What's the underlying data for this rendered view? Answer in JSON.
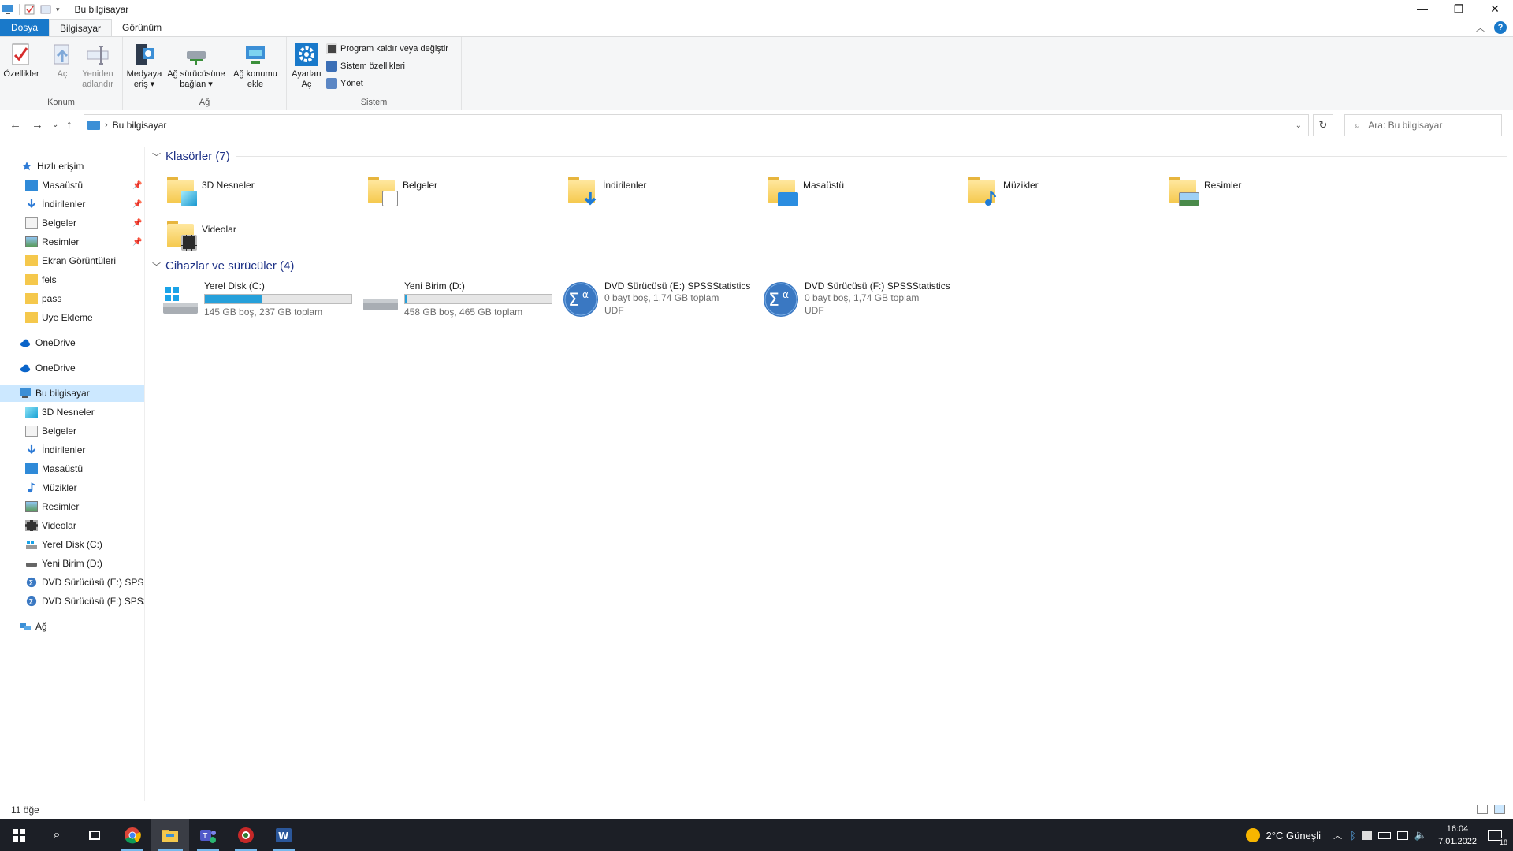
{
  "window": {
    "title": "Bu bilgisayar",
    "controls": {
      "minimize": "—",
      "maximize": "❐",
      "close": "✕"
    }
  },
  "ribbon_tabs": [
    {
      "label": "Dosya"
    },
    {
      "label": "Bilgisayar"
    },
    {
      "label": "Görünüm"
    }
  ],
  "ribbon": {
    "groups": {
      "konum": "Konum",
      "ag": "Ağ",
      "sistem": "Sistem"
    },
    "buttons": {
      "ozellikler": "Özellikler",
      "ac": "Aç",
      "yeniden_line1": "Yeniden",
      "yeniden_line2": "adlandır",
      "medya_line1": "Medyaya",
      "medya_line2": "eriş",
      "agsurucu_line1": "Ağ sürücüsüne",
      "agsurucu_line2": "bağlan",
      "agkonum_line1": "Ağ konumu",
      "agkonum_line2": "ekle",
      "ayarlar_line1": "Ayarları",
      "ayarlar_line2": "Aç",
      "program": "Program kaldır veya değiştir",
      "sistem_ozellikleri": "Sistem özellikleri",
      "yonet": "Yönet"
    }
  },
  "address": {
    "path": "Bu bilgisayar",
    "search_placeholder": "Ara: Bu bilgisayar"
  },
  "sidebar": {
    "quick_access": "Hızlı erişim",
    "quick_items": [
      {
        "label": "Masaüstü",
        "pinned": true
      },
      {
        "label": "İndirilenler",
        "pinned": true
      },
      {
        "label": "Belgeler",
        "pinned": true
      },
      {
        "label": "Resimler",
        "pinned": true
      },
      {
        "label": "Ekran Görüntüleri",
        "pinned": false
      },
      {
        "label": "fels",
        "pinned": false
      },
      {
        "label": "pass",
        "pinned": false
      },
      {
        "label": "Uye Ekleme",
        "pinned": false
      }
    ],
    "onedrive1": "OneDrive",
    "onedrive2": "OneDrive",
    "this_pc": "Bu bilgisayar",
    "pc_items": [
      {
        "label": "3D Nesneler"
      },
      {
        "label": "Belgeler"
      },
      {
        "label": "İndirilenler"
      },
      {
        "label": "Masaüstü"
      },
      {
        "label": "Müzikler"
      },
      {
        "label": "Resimler"
      },
      {
        "label": "Videolar"
      },
      {
        "label": "Yerel Disk (C:)"
      },
      {
        "label": "Yeni Birim (D:)"
      },
      {
        "label": "DVD Sürücüsü (E:) SPSSStatistics"
      },
      {
        "label": "DVD Sürücüsü (F:) SPSSStatistics"
      }
    ],
    "network": "Ağ"
  },
  "content": {
    "folders_header": "Klasörler (7)",
    "folders": [
      {
        "name": "3D Nesneler"
      },
      {
        "name": "Belgeler"
      },
      {
        "name": "İndirilenler"
      },
      {
        "name": "Masaüstü"
      },
      {
        "name": "Müzikler"
      },
      {
        "name": "Resimler"
      },
      {
        "name": "Videolar"
      }
    ],
    "devices_header": "Cihazlar ve sürücüler (4)",
    "drives": [
      {
        "name": "Yerel Disk (C:)",
        "line1": "145 GB boş, 237 GB toplam",
        "line2": "",
        "used_fraction": 0.388
      },
      {
        "name": "Yeni Birim (D:)",
        "line1": "458 GB boş, 465 GB toplam",
        "line2": "",
        "used_fraction": 0.015
      },
      {
        "name": "DVD Sürücüsü (E:) SPSSStatistics",
        "line1": "0 bayt boş, 1,74 GB toplam",
        "line2": "UDF"
      },
      {
        "name": "DVD Sürücüsü (F:) SPSSStatistics",
        "line1": "0 bayt boş, 1,74 GB toplam",
        "line2": "UDF"
      }
    ]
  },
  "status": {
    "item_count": "11 öğe"
  },
  "taskbar": {
    "weather": "2°C  Güneşli",
    "time": "16:04",
    "date": "7.01.2022",
    "notifications": "18"
  },
  "colors": {
    "accent": "#1979ca",
    "selection": "#cce8ff",
    "drive_fill": "#26a0da",
    "taskbar": "#1c1f26"
  }
}
